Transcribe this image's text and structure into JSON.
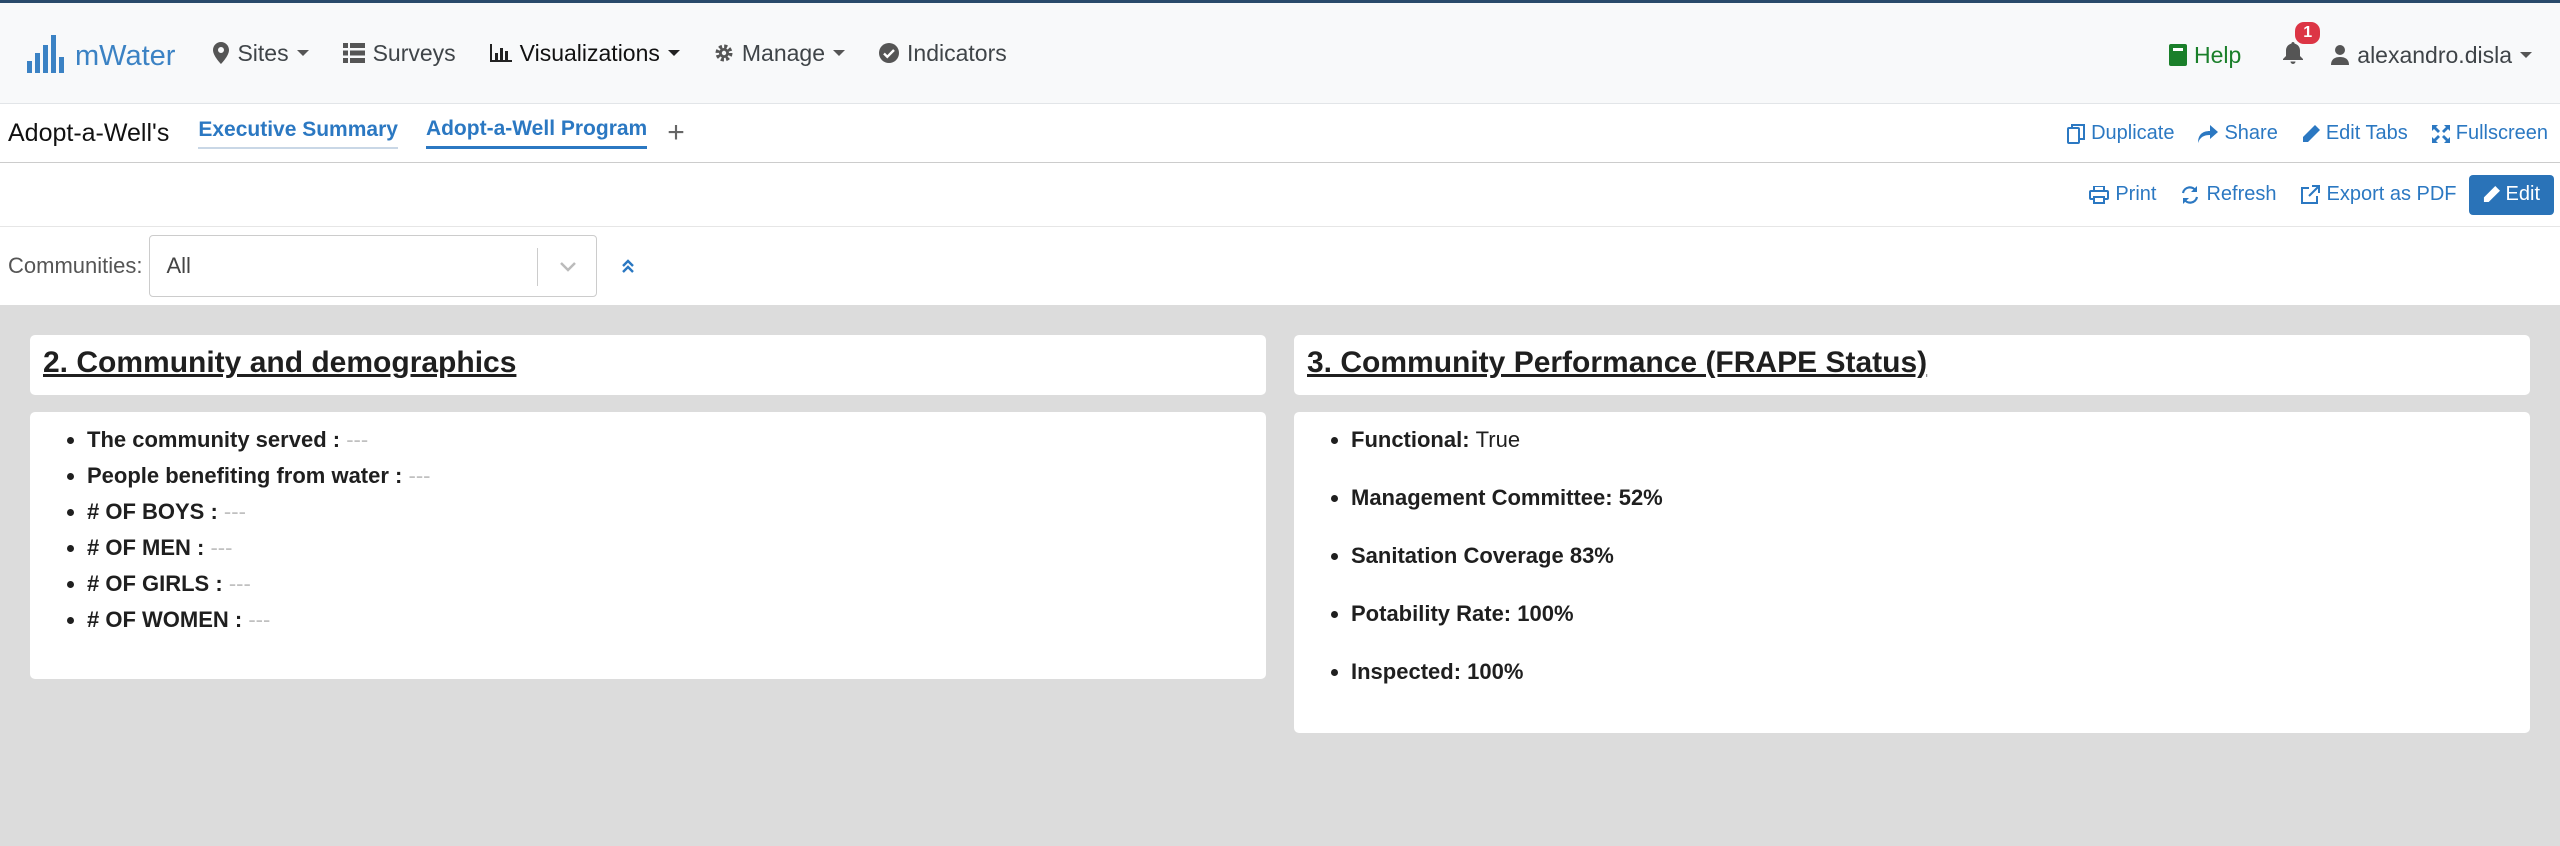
{
  "app": {
    "brand": "mWater"
  },
  "nav": {
    "items": [
      {
        "label": "Sites",
        "icon": "map-marker-icon",
        "dropdown": true
      },
      {
        "label": "Surveys",
        "icon": "list-icon",
        "dropdown": false
      },
      {
        "label": "Visualizations",
        "icon": "bar-chart-icon",
        "dropdown": true
      },
      {
        "label": "Manage",
        "icon": "gear-icon",
        "dropdown": true
      },
      {
        "label": "Indicators",
        "icon": "check-circle-icon",
        "dropdown": false
      }
    ],
    "help_label": "Help",
    "notification_count": "1",
    "user_name": "alexandro.disla"
  },
  "dashboard": {
    "title": "Adopt-a-Well's",
    "tabs": [
      {
        "label": "Executive Summary",
        "active": false
      },
      {
        "label": "Adopt-a-Well Program",
        "active": true
      }
    ],
    "add_tab": "+",
    "actions": {
      "duplicate": "Duplicate",
      "share": "Share",
      "edit_tabs": "Edit Tabs",
      "fullscreen": "Fullscreen"
    }
  },
  "toolbar": {
    "print": "Print",
    "refresh": "Refresh",
    "export_pdf": "Export as PDF",
    "edit": "Edit"
  },
  "filters": {
    "communities_label": "Communities:",
    "communities_value": "All"
  },
  "colors": {
    "accent": "#2b78c2",
    "brand": "#3b82c4",
    "help": "#1a7f2a",
    "badge": "#dc3545",
    "content_bg": "#dcdcdc"
  },
  "sections": {
    "left": {
      "title": "2. Community and demographics",
      "items": [
        {
          "label": "The community served :",
          "value": "---"
        },
        {
          "label": "People benefiting from water :",
          "value": "---"
        },
        {
          "label": "# OF BOYS :",
          "value": "---"
        },
        {
          "label": "# OF MEN :",
          "value": "---"
        },
        {
          "label": "# OF GIRLS :",
          "value": "---"
        },
        {
          "label": "# OF WOMEN :",
          "value": "---"
        }
      ]
    },
    "right": {
      "title": "3. Community Performance (FRAPE Status)",
      "items": [
        {
          "label": "Functional:",
          "value": "True"
        },
        {
          "label": "Management Committee: 52%"
        },
        {
          "label": "Sanitation Coverage 83%"
        },
        {
          "label": "Potability Rate: 100%"
        },
        {
          "label": "Inspected: 100%"
        }
      ]
    }
  }
}
